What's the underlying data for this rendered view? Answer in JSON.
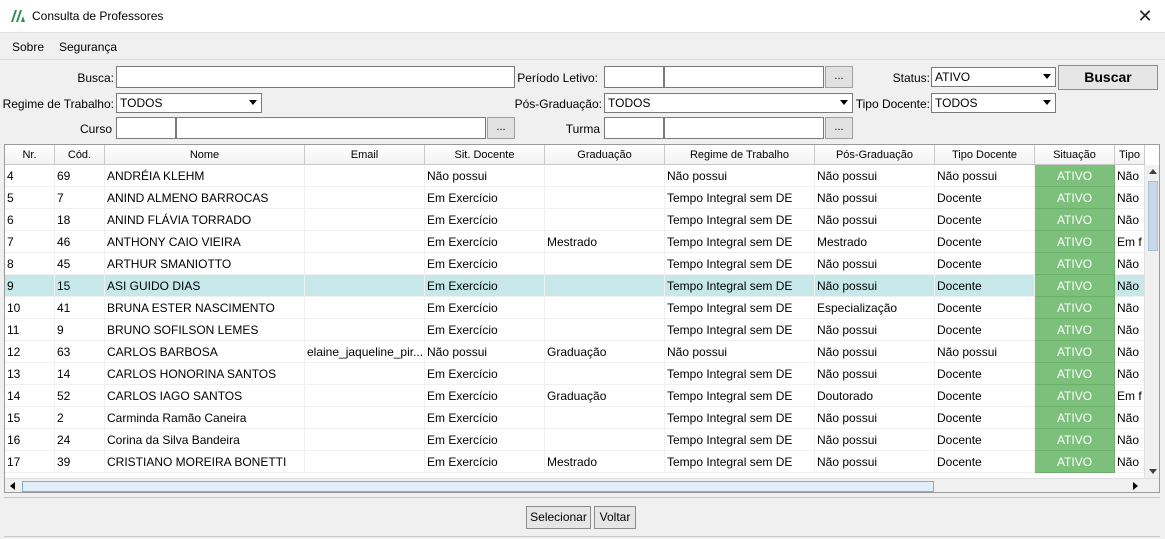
{
  "window": {
    "title": "Consulta de Professores",
    "close_icon": "close-icon"
  },
  "menu": [
    "Sobre",
    "Segurança"
  ],
  "filters": {
    "busca_label": "Busca:",
    "busca_value": "",
    "periodo_label": "Período Letivo:",
    "periodo_code": "",
    "periodo_desc": "",
    "periodo_btn": "...",
    "status_label": "Status:",
    "status_value": "ATIVO",
    "buscar_label": "Buscar",
    "regime_label": "Regime de Trabalho:",
    "regime_value": "TODOS",
    "pos_label": "Pós-Graduação:",
    "pos_value": "TODOS",
    "tipo_label": "Tipo Docente:",
    "tipo_value": "TODOS",
    "curso_label": "Curso",
    "curso_code": "",
    "curso_desc": "",
    "curso_btn": "...",
    "turma_label": "Turma",
    "turma_code": "",
    "turma_desc": "",
    "turma_btn": "..."
  },
  "table": {
    "columns": [
      "Nr.",
      "Cód.",
      "Nome",
      "Email",
      "Sit. Docente",
      "Graduação",
      "Regime de Trabalho",
      "Pós-Graduação",
      "Tipo Docente",
      "Situação",
      "Tipo"
    ],
    "selected_index": 5,
    "rows": [
      [
        "4",
        "69",
        "ANDRÉIA KLEHM",
        "",
        "Não possui",
        "",
        "Não possui",
        "Não possui",
        "Não possui",
        "ATIVO",
        "Não"
      ],
      [
        "5",
        "7",
        "ANIND ALMENO BARROCAS",
        "",
        "Em Exercício",
        "",
        "Tempo Integral sem DE",
        "Não possui",
        "Docente",
        "ATIVO",
        "Não"
      ],
      [
        "6",
        "18",
        "ANIND FLÁVIA TORRADO",
        "",
        "Em Exercício",
        "",
        "Tempo Integral sem DE",
        "Não possui",
        "Docente",
        "ATIVO",
        "Não"
      ],
      [
        "7",
        "46",
        "ANTHONY CAIO VIEIRA",
        "",
        "Em Exercício",
        "Mestrado",
        "Tempo Integral sem DE",
        "Mestrado",
        "Docente",
        "ATIVO",
        "Em f"
      ],
      [
        "8",
        "45",
        "ARTHUR SMANIOTTO",
        "",
        "Em Exercício",
        "",
        "Tempo Integral sem DE",
        "Não possui",
        "Docente",
        "ATIVO",
        "Não"
      ],
      [
        "9",
        "15",
        "ASI GUIDO DIAS",
        "",
        "Em Exercício",
        "",
        "Tempo Integral sem DE",
        "Não possui",
        "Docente",
        "ATIVO",
        "Não"
      ],
      [
        "10",
        "41",
        "BRUNA ESTER NASCIMENTO",
        "",
        "Em Exercício",
        "",
        "Tempo Integral sem DE",
        "Especialização",
        "Docente",
        "ATIVO",
        "Não"
      ],
      [
        "11",
        "9",
        "BRUNO SOFILSON LEMES",
        "",
        "Em Exercício",
        "",
        "Tempo Integral sem DE",
        "Não possui",
        "Docente",
        "ATIVO",
        "Não"
      ],
      [
        "12",
        "63",
        "CARLOS BARBOSA",
        "elaine_jaqueline_pir...",
        "Não possui",
        "Graduação",
        "Não possui",
        "Não possui",
        "Não possui",
        "ATIVO",
        "Não"
      ],
      [
        "13",
        "14",
        "CARLOS HONORINA SANTOS",
        "",
        "Em Exercício",
        "",
        "Tempo Integral sem DE",
        "Não possui",
        "Docente",
        "ATIVO",
        "Não"
      ],
      [
        "14",
        "52",
        "CARLOS IAGO SANTOS",
        "",
        "Em Exercício",
        "Graduação",
        "Tempo Integral sem DE",
        "Doutorado",
        "Docente",
        "ATIVO",
        "Em f"
      ],
      [
        "15",
        "2",
        "Carminda Ramão Caneira",
        "",
        "Em Exercício",
        "",
        "Tempo Integral sem DE",
        "Não possui",
        "Docente",
        "ATIVO",
        "Não"
      ],
      [
        "16",
        "24",
        "Corina da Silva Bandeira",
        "",
        "Em Exercício",
        "",
        "Tempo Integral sem DE",
        "Não possui",
        "Docente",
        "ATIVO",
        "Não"
      ],
      [
        "17",
        "39",
        "CRISTIANO MOREIRA BONETTI",
        "",
        "Em Exercício",
        "Mestrado",
        "Tempo Integral sem DE",
        "Não possui",
        "Docente",
        "ATIVO",
        "Não"
      ]
    ]
  },
  "footer": {
    "selecionar_label": "Selecionar",
    "voltar_label": "Voltar"
  }
}
